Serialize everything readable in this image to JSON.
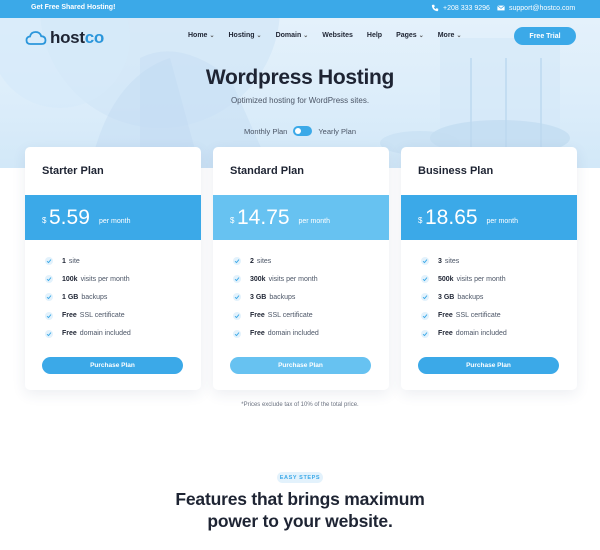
{
  "topbar": {
    "promo": "Get Free Shared Hosting!",
    "phone": "+208 333 9296",
    "email": "support@hostco.com"
  },
  "brand": {
    "logo_a": "host",
    "logo_b": "co"
  },
  "nav": {
    "items": [
      {
        "label": "Home",
        "dropdown": true
      },
      {
        "label": "Hosting",
        "dropdown": true
      },
      {
        "label": "Domain",
        "dropdown": true
      },
      {
        "label": "Websites",
        "dropdown": false
      },
      {
        "label": "Help",
        "dropdown": false
      },
      {
        "label": "Pages",
        "dropdown": true
      },
      {
        "label": "More",
        "dropdown": true
      }
    ],
    "cta": "Free Trial"
  },
  "hero": {
    "title": "Wordpress Hosting",
    "subtitle": "Optimized hosting for WordPress sites.",
    "toggle_left": "Monthly Plan",
    "toggle_right": "Yearly Plan"
  },
  "plans": [
    {
      "name": "Starter Plan",
      "currency": "$",
      "price": "5.59",
      "period": "per month",
      "features": [
        {
          "bold": "1",
          "text": "site"
        },
        {
          "bold": "100k",
          "text": "visits per month"
        },
        {
          "bold": "1 GB",
          "text": "backups"
        },
        {
          "bold": "Free",
          "text": "SSL certificate"
        },
        {
          "bold": "Free",
          "text": "domain included"
        }
      ],
      "button": "Purchase Plan"
    },
    {
      "name": "Standard Plan",
      "currency": "$",
      "price": "14.75",
      "period": "per month",
      "features": [
        {
          "bold": "2",
          "text": "sites"
        },
        {
          "bold": "300k",
          "text": "visits per month"
        },
        {
          "bold": "3 GB",
          "text": "backups"
        },
        {
          "bold": "Free",
          "text": "SSL certificate"
        },
        {
          "bold": "Free",
          "text": "domain included"
        }
      ],
      "button": "Purchase Plan"
    },
    {
      "name": "Business Plan",
      "currency": "$",
      "price": "18.65",
      "period": "per month",
      "features": [
        {
          "bold": "3",
          "text": "sites"
        },
        {
          "bold": "500k",
          "text": "visits per month"
        },
        {
          "bold": "3 GB",
          "text": "backups"
        },
        {
          "bold": "Free",
          "text": "SSL certificate"
        },
        {
          "bold": "Free",
          "text": "domain included"
        }
      ],
      "button": "Purchase Plan"
    }
  ],
  "note": "*Prices exclude tax of 10% of the total price.",
  "steps": {
    "badge": "EASY STEPS",
    "title_line1": "Features that brings maximum",
    "title_line2": "power to your website."
  },
  "colors": {
    "accent": "#3ba9e8",
    "accent_light": "#67c2f1",
    "text": "#1e2433"
  }
}
